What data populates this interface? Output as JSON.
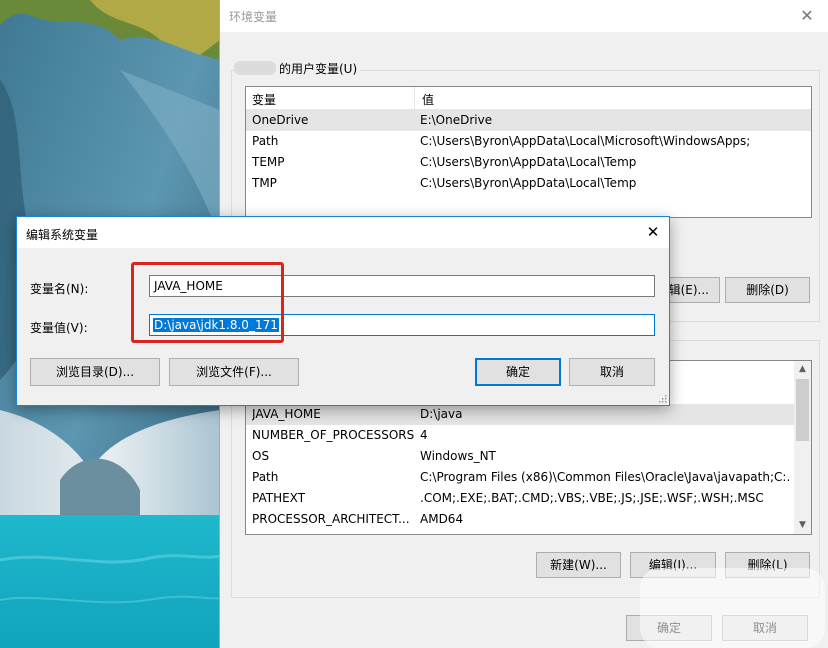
{
  "env_window": {
    "title": "环境变量",
    "user_section_label": "的用户变量(U)",
    "columns": {
      "name": "变量",
      "value": "值"
    },
    "user_vars": [
      {
        "name": "OneDrive",
        "value": "E:\\OneDrive"
      },
      {
        "name": "Path",
        "value": "C:\\Users\\Byron\\AppData\\Local\\Microsoft\\WindowsApps;"
      },
      {
        "name": "TEMP",
        "value": "C:\\Users\\Byron\\AppData\\Local\\Temp"
      },
      {
        "name": "TMP",
        "value": "C:\\Users\\Byron\\AppData\\Local\\Temp"
      }
    ],
    "user_buttons": {
      "edit": "辑(E)...",
      "delete": "删除(D)"
    },
    "system_vars": [
      {
        "name": "JAVA_HOME",
        "value": "D:\\java"
      },
      {
        "name": "NUMBER_OF_PROCESSORS",
        "value": "4"
      },
      {
        "name": "OS",
        "value": "Windows_NT"
      },
      {
        "name": "Path",
        "value": "C:\\Program Files (x86)\\Common Files\\Oracle\\Java\\javapath;C:..."
      },
      {
        "name": "PATHEXT",
        "value": ".COM;.EXE;.BAT;.CMD;.VBS;.VBE;.JS;.JSE;.WSF;.WSH;.MSC"
      },
      {
        "name": "PROCESSOR_ARCHITECT...",
        "value": "AMD64"
      }
    ],
    "system_buttons": {
      "new": "新建(W)...",
      "edit": "编辑(I)...",
      "delete": "删除(L)"
    },
    "footer_buttons": {
      "ok": "确定",
      "cancel": "取消"
    }
  },
  "edit_dialog": {
    "title": "编辑系统变量",
    "name_label": "变量名(N):",
    "name_value": "JAVA_HOME",
    "value_label": "变量值(V):",
    "value_value": "D:\\java\\jdk1.8.0_171",
    "browse_dir": "浏览目录(D)...",
    "browse_file": "浏览文件(F)...",
    "ok": "确定",
    "cancel": "取消"
  },
  "colors": {
    "highlight": "#d9251d",
    "selection": "#0078d7",
    "window_bg": "#f0f0f0"
  }
}
